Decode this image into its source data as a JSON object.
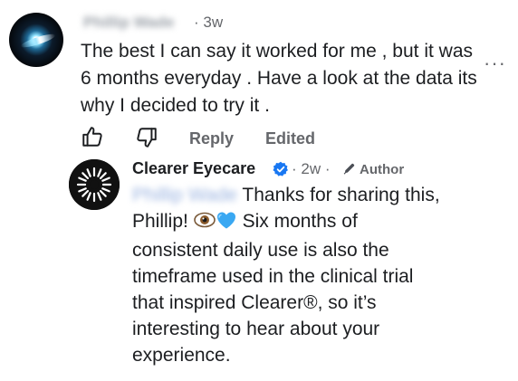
{
  "comment": {
    "author_name": "Phillip Wade",
    "time": "· 3w",
    "text": "The best I can say it worked for me , but it was 6 months everyday . Have a look at the data its why I decided to try it .",
    "more_label": "···",
    "actions": {
      "like_icon": "thumbs-up-icon",
      "dislike_icon": "thumbs-down-icon",
      "reply_label": "Reply",
      "edited_label": "Edited"
    }
  },
  "reply": {
    "author_name": "Clearer Eyecare",
    "verified_icon": "verified-badge-icon",
    "time": "· 2w ·",
    "author_badge_icon": "pen-icon",
    "author_badge_label": "Author",
    "mention": "Phillip Wade",
    "text_part1": "Thanks for sharing this, Phillip!",
    "emoji1": "eye-emoji",
    "emoji2": "blue-heart-emoji",
    "text_part2": "Six months of consistent daily use is also the timeframe used in the clinical trial that inspired Clearer®, so it’s interesting to hear about your experience."
  },
  "colors": {
    "text": "#1c1e21",
    "secondary": "#65676b",
    "verified_blue": "#1877f2",
    "heart_blue": "#3aa8f2"
  }
}
